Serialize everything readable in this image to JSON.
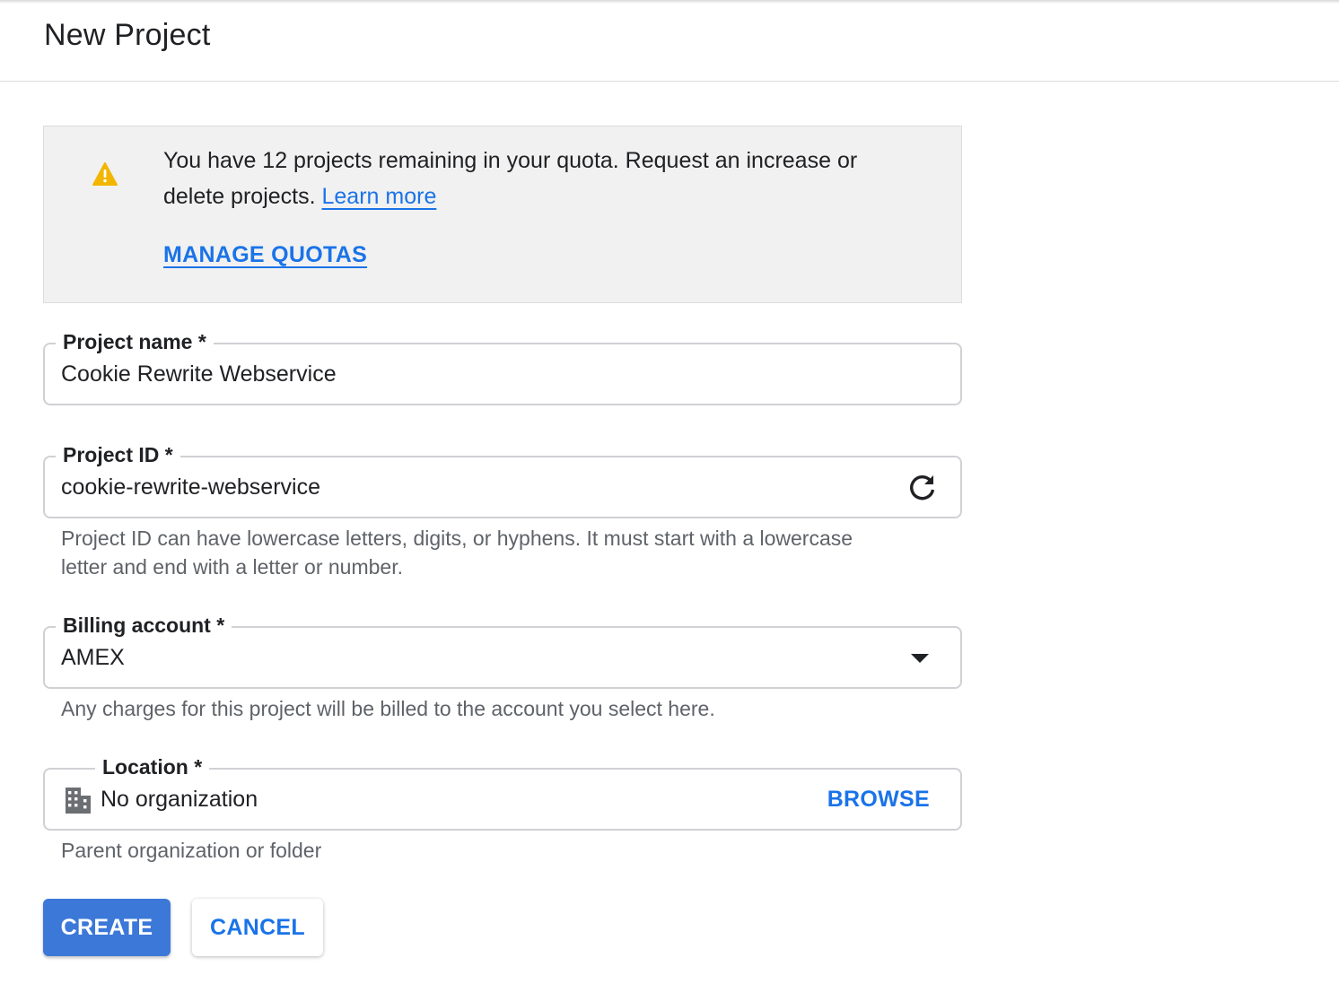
{
  "header": {
    "title": "New Project"
  },
  "notice": {
    "message": "You have 12 projects remaining in your quota. Request an increase or delete projects.",
    "learn_more": "Learn more",
    "manage_quotas": "MANAGE QUOTAS",
    "icon": "warning-icon",
    "icon_color": "#f2b600"
  },
  "fields": {
    "project_name": {
      "label": "Project name *",
      "value": "Cookie Rewrite Webservice"
    },
    "project_id": {
      "label": "Project ID *",
      "value": "cookie-rewrite-webservice",
      "hint_line1": "Project ID can have lowercase letters, digits, or hyphens. It must start with a lowercase",
      "hint_line2": "letter and end with a letter or number.",
      "icon": "refresh-icon"
    },
    "billing_account": {
      "label": "Billing account *",
      "value": "AMEX",
      "hint": "Any charges for this project will be billed to the account you select here.",
      "icon": "dropdown-arrow-icon"
    },
    "location": {
      "label": "Location *",
      "value": "No organization",
      "browse": "BROWSE",
      "hint": "Parent organization or folder",
      "icon": "building-icon"
    }
  },
  "actions": {
    "create": "CREATE",
    "cancel": "CANCEL"
  },
  "colors": {
    "accent": "#1a73e8",
    "primary_button": "#3c78d8",
    "warning": "#f2b600"
  }
}
